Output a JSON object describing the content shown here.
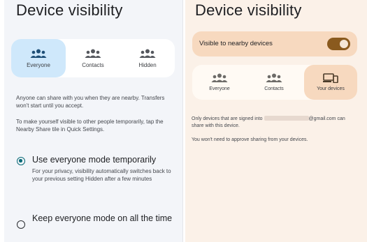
{
  "left": {
    "title": "Device visibility",
    "tabs": [
      {
        "label": "Everyone",
        "icon": "people-icon",
        "selected": true
      },
      {
        "label": "Contacts",
        "icon": "contacts-icon",
        "selected": false
      },
      {
        "label": "Hidden",
        "icon": "people-icon",
        "selected": false
      }
    ],
    "description": "Anyone can share with you when they are nearby. Transfers won't start until you accept.",
    "tip": "To make yourself visible to other people temporarily, tap the Nearby Share tile in Quick Settings.",
    "options": [
      {
        "title": "Use everyone mode temporarily",
        "subtitle": "For your privacy, visibility automatically switches back to your previous setting Hidden after a few minutes",
        "checked": true
      },
      {
        "title": "Keep everyone mode on all the time",
        "subtitle": "",
        "checked": false
      }
    ]
  },
  "right": {
    "title": "Device visibility",
    "toggle_label": "Visible to nearby devices",
    "toggle_on": true,
    "tabs": [
      {
        "label": "Everyone",
        "icon": "people-icon",
        "selected": false
      },
      {
        "label": "Contacts",
        "icon": "contacts-icon",
        "selected": false
      },
      {
        "label": "Your devices",
        "icon": "devices-icon",
        "selected": true
      }
    ],
    "info_prefix": "Only devices that are signed into",
    "info_email_suffix": "@gmail.com can",
    "info_line2": "share with this device.",
    "note": "You won't need to approve sharing from your devices."
  },
  "colors": {
    "left_bg": "#f3f5f9",
    "right_bg": "#fbf1e8",
    "selected_blue": "#cfe8fb",
    "selected_orange": "#f7d9bf",
    "toggle_track": "#8a5a1e",
    "radio_accent": "#0b6b78"
  }
}
